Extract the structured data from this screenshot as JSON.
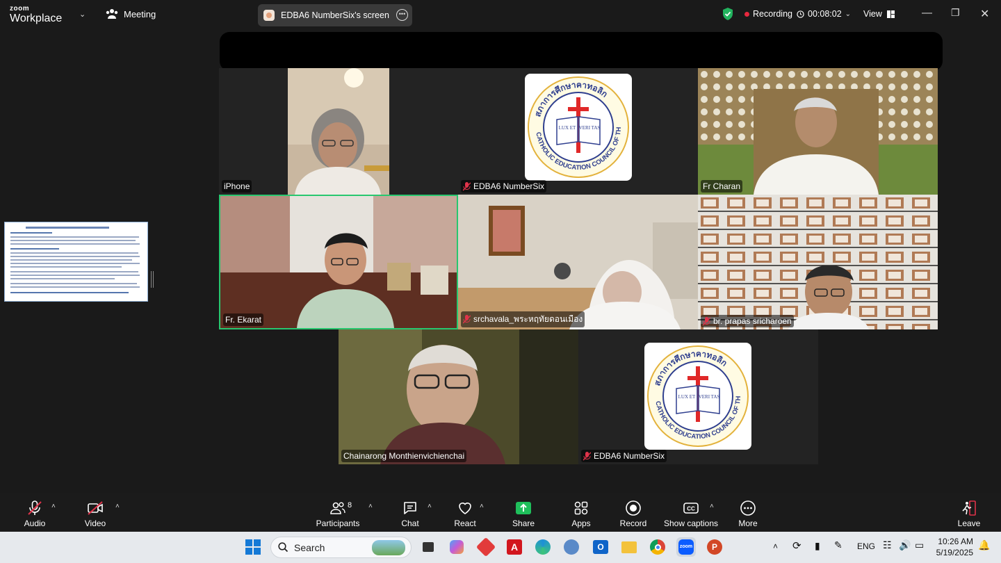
{
  "app": {
    "brand_top": "zoom",
    "brand_bottom": "Workplace",
    "meeting_label": "Meeting"
  },
  "share_pill": {
    "title": "EDBA6 NumberSix's screen"
  },
  "status": {
    "recording_label": "Recording",
    "timer": "00:08:02",
    "view_label": "View"
  },
  "tiles": [
    {
      "name": "iPhone",
      "muted": false
    },
    {
      "name": "EDBA6 NumberSix",
      "muted": true
    },
    {
      "name": "Fr Charan",
      "muted": false
    },
    {
      "name": "Fr. Ekarat",
      "muted": false,
      "active_speaker": true
    },
    {
      "name": "srchavala_พระหฤทัยดอนเมือง",
      "muted": true
    },
    {
      "name": "br. prapas sricharoen",
      "muted": true
    },
    {
      "name": "Chainarong Monthienvichienchai",
      "muted": false
    },
    {
      "name": "EDBA6 NumberSix",
      "muted": true
    }
  ],
  "logo": {
    "thai_arc": "สภาการศึกษาคาทอลิก",
    "english_arc": "CATHOLIC EDUCATION COUNCIL OF THAILAND",
    "book_left": "LUX ET",
    "book_right": "VERI TAS"
  },
  "toolbar": {
    "audio": "Audio",
    "video": "Video",
    "participants": "Participants",
    "participants_count": "8",
    "chat": "Chat",
    "react": "React",
    "share": "Share",
    "apps": "Apps",
    "record": "Record",
    "captions": "Show captions",
    "more": "More",
    "leave": "Leave"
  },
  "taskbar": {
    "search_placeholder": "Search",
    "lang": "ENG",
    "time": "10:26 AM",
    "date": "5/19/2025"
  },
  "colors": {
    "active_border": "#28c76f",
    "share_green": "#1fbf5b",
    "record_red": "#e8283e",
    "mute_red": "#e0334a"
  }
}
